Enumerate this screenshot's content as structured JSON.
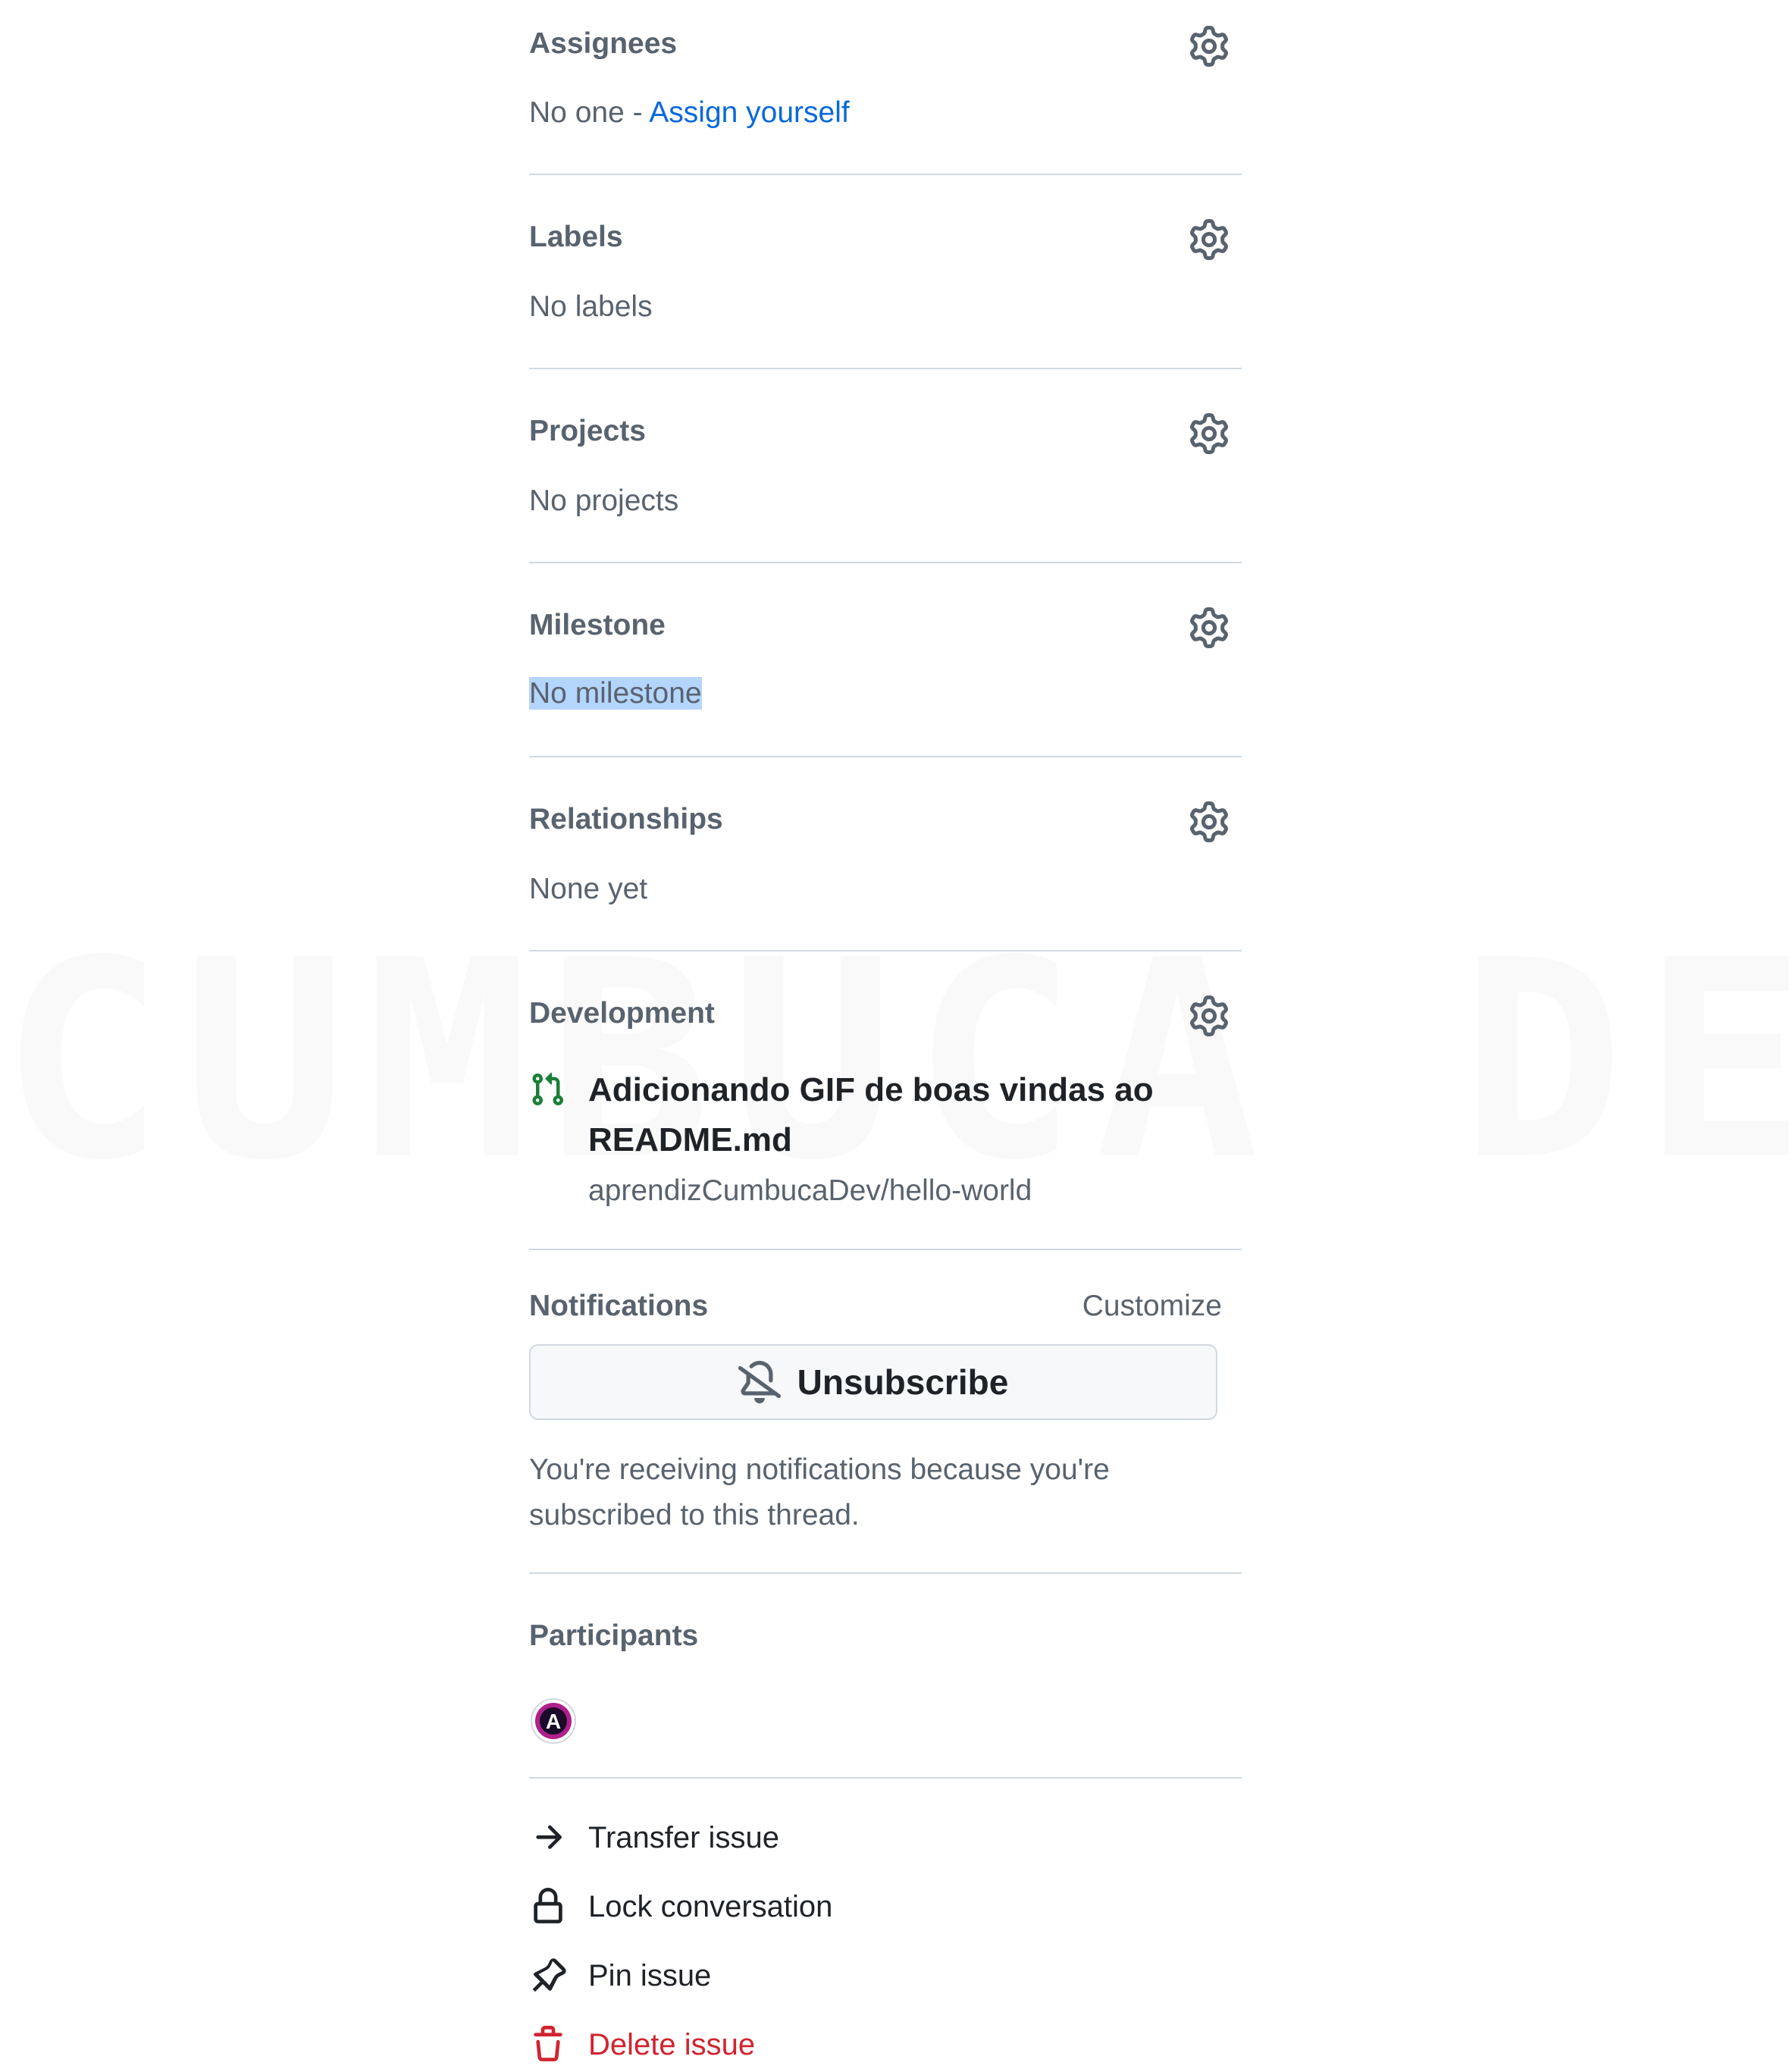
{
  "sections": {
    "assignees": {
      "title": "Assignees",
      "value_prefix": "No one -",
      "action_link": "Assign yourself"
    },
    "labels": {
      "title": "Labels",
      "value": "No labels"
    },
    "projects": {
      "title": "Projects",
      "value": "No projects"
    },
    "milestone": {
      "title": "Milestone",
      "value": "No milestone"
    },
    "relationships": {
      "title": "Relationships",
      "value": "None yet"
    },
    "development": {
      "title": "Development",
      "pr_title": "Adicionando GIF de boas vindas ao README.md",
      "pr_repo": "aprendizCumbucaDev/hello-world",
      "pr_icon": "git-pull-request-icon"
    },
    "notifications": {
      "title": "Notifications",
      "customize_label": "Customize",
      "button_label": "Unsubscribe",
      "button_icon": "bell-slash-icon",
      "note": "You're receiving notifications because you're subscribed to this thread."
    },
    "participants": {
      "title": "Participants",
      "avatar_letter": "A"
    }
  },
  "actions": [
    {
      "label": "Transfer issue",
      "icon": "arrow-right-icon"
    },
    {
      "label": "Lock conversation",
      "icon": "lock-icon"
    },
    {
      "label": "Pin issue",
      "icon": "pin-icon"
    },
    {
      "label": "Delete issue",
      "icon": "trash-icon"
    }
  ],
  "watermark": "CUMBUCA DEV",
  "colors": {
    "link": "#0969da",
    "muted": "#59636e",
    "danger": "#d1242f",
    "pr_open": "#1a7f37",
    "selection": "#b4d5fe"
  }
}
